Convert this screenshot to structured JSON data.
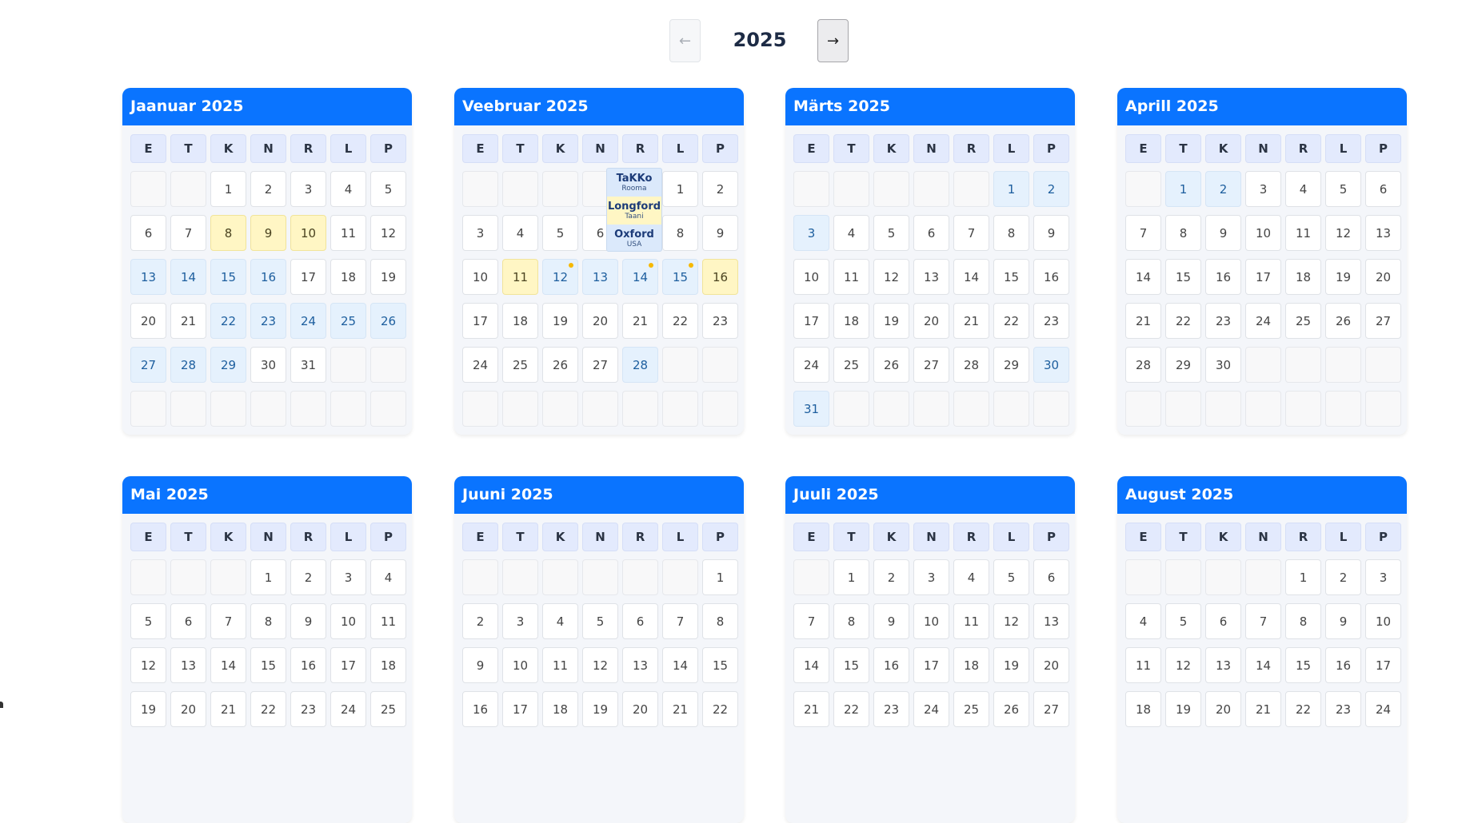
{
  "nav": {
    "prev_label": "←",
    "next_label": "→",
    "year": "2025"
  },
  "weekdays": [
    "E",
    "T",
    "K",
    "N",
    "R",
    "L",
    "P"
  ],
  "months": [
    {
      "title": "Jaanuar 2025",
      "cells": [
        {
          "t": ""
        },
        {
          "t": ""
        },
        {
          "t": "1"
        },
        {
          "t": "2"
        },
        {
          "t": "3"
        },
        {
          "t": "4"
        },
        {
          "t": "5"
        },
        {
          "t": "6"
        },
        {
          "t": "7"
        },
        {
          "t": "8",
          "s": "yellow"
        },
        {
          "t": "9",
          "s": "yellow"
        },
        {
          "t": "10",
          "s": "yellow"
        },
        {
          "t": "11"
        },
        {
          "t": "12"
        },
        {
          "t": "13",
          "s": "blue"
        },
        {
          "t": "14",
          "s": "blue"
        },
        {
          "t": "15",
          "s": "blue"
        },
        {
          "t": "16",
          "s": "blue"
        },
        {
          "t": "17"
        },
        {
          "t": "18"
        },
        {
          "t": "19"
        },
        {
          "t": "20"
        },
        {
          "t": "21"
        },
        {
          "t": "22",
          "s": "blue"
        },
        {
          "t": "23",
          "s": "blue"
        },
        {
          "t": "24",
          "s": "blue"
        },
        {
          "t": "25",
          "s": "blue"
        },
        {
          "t": "26",
          "s": "blue"
        },
        {
          "t": "27",
          "s": "blue"
        },
        {
          "t": "28",
          "s": "blue"
        },
        {
          "t": "29",
          "s": "blue"
        },
        {
          "t": "30"
        },
        {
          "t": "31"
        },
        {
          "t": ""
        },
        {
          "t": ""
        },
        {
          "t": ""
        },
        {
          "t": ""
        },
        {
          "t": ""
        },
        {
          "t": ""
        },
        {
          "t": ""
        },
        {
          "t": ""
        },
        {
          "t": ""
        }
      ]
    },
    {
      "title": "Veebruar 2025",
      "cells": [
        {
          "t": ""
        },
        {
          "t": ""
        },
        {
          "t": ""
        },
        {
          "t": ""
        },
        {
          "t": ""
        },
        {
          "t": "1"
        },
        {
          "t": "2"
        },
        {
          "t": "3"
        },
        {
          "t": "4"
        },
        {
          "t": "5"
        },
        {
          "t": "6"
        },
        {
          "t": "7"
        },
        {
          "t": "8"
        },
        {
          "t": "9"
        },
        {
          "t": "10"
        },
        {
          "t": "11",
          "s": "yellow"
        },
        {
          "t": "12",
          "s": "blue",
          "dot": true
        },
        {
          "t": "13",
          "s": "blue"
        },
        {
          "t": "14",
          "s": "blue",
          "dot": true
        },
        {
          "t": "15",
          "s": "blue",
          "dot": true
        },
        {
          "t": "16",
          "s": "yellow"
        },
        {
          "t": "17"
        },
        {
          "t": "18"
        },
        {
          "t": "19"
        },
        {
          "t": "20"
        },
        {
          "t": "21"
        },
        {
          "t": "22"
        },
        {
          "t": "23"
        },
        {
          "t": "24"
        },
        {
          "t": "25"
        },
        {
          "t": "26"
        },
        {
          "t": "27"
        },
        {
          "t": "28",
          "s": "blue"
        },
        {
          "t": ""
        },
        {
          "t": ""
        },
        {
          "t": ""
        },
        {
          "t": ""
        },
        {
          "t": ""
        },
        {
          "t": ""
        },
        {
          "t": ""
        },
        {
          "t": ""
        },
        {
          "t": ""
        }
      ]
    },
    {
      "title": "Märts 2025",
      "cells": [
        {
          "t": ""
        },
        {
          "t": ""
        },
        {
          "t": ""
        },
        {
          "t": ""
        },
        {
          "t": ""
        },
        {
          "t": "1",
          "s": "blue"
        },
        {
          "t": "2",
          "s": "blue"
        },
        {
          "t": "3",
          "s": "blue"
        },
        {
          "t": "4"
        },
        {
          "t": "5"
        },
        {
          "t": "6"
        },
        {
          "t": "7"
        },
        {
          "t": "8"
        },
        {
          "t": "9"
        },
        {
          "t": "10"
        },
        {
          "t": "11"
        },
        {
          "t": "12"
        },
        {
          "t": "13"
        },
        {
          "t": "14"
        },
        {
          "t": "15"
        },
        {
          "t": "16"
        },
        {
          "t": "17"
        },
        {
          "t": "18"
        },
        {
          "t": "19"
        },
        {
          "t": "20"
        },
        {
          "t": "21"
        },
        {
          "t": "22"
        },
        {
          "t": "23"
        },
        {
          "t": "24"
        },
        {
          "t": "25"
        },
        {
          "t": "26"
        },
        {
          "t": "27"
        },
        {
          "t": "28"
        },
        {
          "t": "29"
        },
        {
          "t": "30",
          "s": "blue"
        },
        {
          "t": "31",
          "s": "blue"
        },
        {
          "t": ""
        },
        {
          "t": ""
        },
        {
          "t": ""
        },
        {
          "t": ""
        },
        {
          "t": ""
        },
        {
          "t": ""
        }
      ]
    },
    {
      "title": "Aprill 2025",
      "cells": [
        {
          "t": ""
        },
        {
          "t": "1",
          "s": "blue"
        },
        {
          "t": "2",
          "s": "blue"
        },
        {
          "t": "3"
        },
        {
          "t": "4"
        },
        {
          "t": "5"
        },
        {
          "t": "6"
        },
        {
          "t": "7"
        },
        {
          "t": "8"
        },
        {
          "t": "9"
        },
        {
          "t": "10"
        },
        {
          "t": "11"
        },
        {
          "t": "12"
        },
        {
          "t": "13"
        },
        {
          "t": "14"
        },
        {
          "t": "15"
        },
        {
          "t": "16"
        },
        {
          "t": "17"
        },
        {
          "t": "18"
        },
        {
          "t": "19"
        },
        {
          "t": "20"
        },
        {
          "t": "21"
        },
        {
          "t": "22"
        },
        {
          "t": "23"
        },
        {
          "t": "24"
        },
        {
          "t": "25"
        },
        {
          "t": "26"
        },
        {
          "t": "27"
        },
        {
          "t": "28"
        },
        {
          "t": "29"
        },
        {
          "t": "30"
        },
        {
          "t": ""
        },
        {
          "t": ""
        },
        {
          "t": ""
        },
        {
          "t": ""
        },
        {
          "t": ""
        },
        {
          "t": ""
        },
        {
          "t": ""
        },
        {
          "t": ""
        },
        {
          "t": ""
        },
        {
          "t": ""
        },
        {
          "t": ""
        }
      ]
    },
    {
      "title": "Mai 2025",
      "cells": [
        {
          "t": ""
        },
        {
          "t": ""
        },
        {
          "t": ""
        },
        {
          "t": "1"
        },
        {
          "t": "2"
        },
        {
          "t": "3"
        },
        {
          "t": "4"
        },
        {
          "t": "5"
        },
        {
          "t": "6"
        },
        {
          "t": "7"
        },
        {
          "t": "8"
        },
        {
          "t": "9"
        },
        {
          "t": "10"
        },
        {
          "t": "11"
        },
        {
          "t": "12"
        },
        {
          "t": "13"
        },
        {
          "t": "14"
        },
        {
          "t": "15"
        },
        {
          "t": "16"
        },
        {
          "t": "17"
        },
        {
          "t": "18"
        },
        {
          "t": "19"
        },
        {
          "t": "20"
        },
        {
          "t": "21"
        },
        {
          "t": "22"
        },
        {
          "t": "23"
        },
        {
          "t": "24"
        },
        {
          "t": "25"
        }
      ]
    },
    {
      "title": "Juuni 2025",
      "cells": [
        {
          "t": ""
        },
        {
          "t": ""
        },
        {
          "t": ""
        },
        {
          "t": ""
        },
        {
          "t": ""
        },
        {
          "t": ""
        },
        {
          "t": "1"
        },
        {
          "t": "2"
        },
        {
          "t": "3"
        },
        {
          "t": "4"
        },
        {
          "t": "5"
        },
        {
          "t": "6"
        },
        {
          "t": "7"
        },
        {
          "t": "8"
        },
        {
          "t": "9"
        },
        {
          "t": "10"
        },
        {
          "t": "11"
        },
        {
          "t": "12"
        },
        {
          "t": "13"
        },
        {
          "t": "14"
        },
        {
          "t": "15"
        },
        {
          "t": "16"
        },
        {
          "t": "17"
        },
        {
          "t": "18"
        },
        {
          "t": "19"
        },
        {
          "t": "20"
        },
        {
          "t": "21"
        },
        {
          "t": "22"
        }
      ]
    },
    {
      "title": "Juuli 2025",
      "cells": [
        {
          "t": ""
        },
        {
          "t": "1"
        },
        {
          "t": "2"
        },
        {
          "t": "3"
        },
        {
          "t": "4"
        },
        {
          "t": "5"
        },
        {
          "t": "6"
        },
        {
          "t": "7"
        },
        {
          "t": "8"
        },
        {
          "t": "9"
        },
        {
          "t": "10"
        },
        {
          "t": "11"
        },
        {
          "t": "12"
        },
        {
          "t": "13"
        },
        {
          "t": "14"
        },
        {
          "t": "15"
        },
        {
          "t": "16"
        },
        {
          "t": "17"
        },
        {
          "t": "18"
        },
        {
          "t": "19"
        },
        {
          "t": "20"
        },
        {
          "t": "21"
        },
        {
          "t": "22"
        },
        {
          "t": "23"
        },
        {
          "t": "24"
        },
        {
          "t": "25"
        },
        {
          "t": "26"
        },
        {
          "t": "27"
        }
      ]
    },
    {
      "title": "August 2025",
      "cells": [
        {
          "t": ""
        },
        {
          "t": ""
        },
        {
          "t": ""
        },
        {
          "t": ""
        },
        {
          "t": "1"
        },
        {
          "t": "2"
        },
        {
          "t": "3"
        },
        {
          "t": "4"
        },
        {
          "t": "5"
        },
        {
          "t": "6"
        },
        {
          "t": "7"
        },
        {
          "t": "8"
        },
        {
          "t": "9"
        },
        {
          "t": "10"
        },
        {
          "t": "11"
        },
        {
          "t": "12"
        },
        {
          "t": "13"
        },
        {
          "t": "14"
        },
        {
          "t": "15"
        },
        {
          "t": "16"
        },
        {
          "t": "17"
        },
        {
          "t": "18"
        },
        {
          "t": "19"
        },
        {
          "t": "20"
        },
        {
          "t": "21"
        },
        {
          "t": "22"
        },
        {
          "t": "23"
        },
        {
          "t": "24"
        }
      ]
    }
  ],
  "tooltip": {
    "items": [
      {
        "name": "TaKKo",
        "location": "Rooma",
        "highlight": false
      },
      {
        "name": "Longford",
        "location": "Taani",
        "highlight": true
      },
      {
        "name": "Oxford",
        "location": "USA",
        "highlight": false
      }
    ]
  }
}
